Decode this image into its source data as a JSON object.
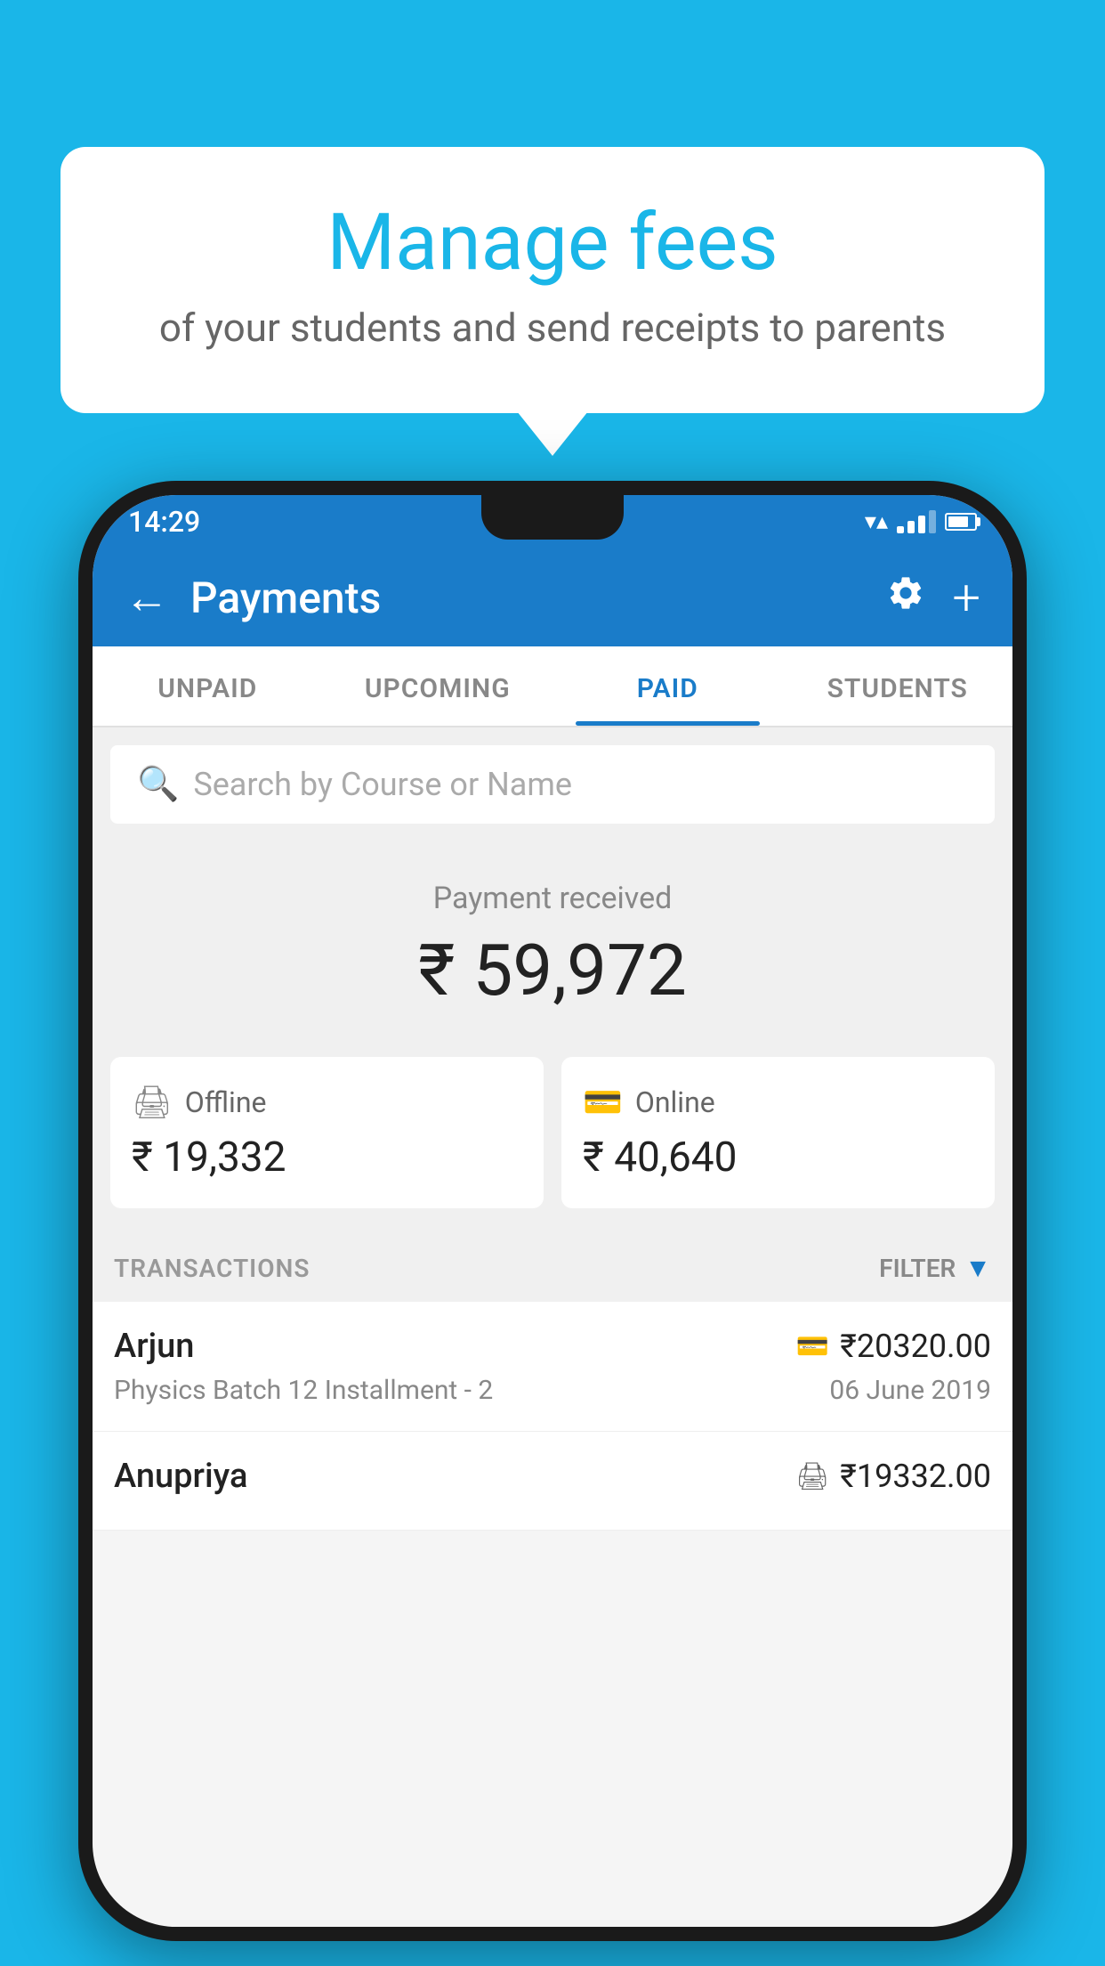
{
  "background_color": "#1ab6e8",
  "speech_bubble": {
    "title": "Manage fees",
    "subtitle": "of your students and send receipts to parents"
  },
  "status_bar": {
    "time": "14:29"
  },
  "app_bar": {
    "title": "Payments",
    "back_label": "←",
    "settings_label": "⚙",
    "add_label": "+"
  },
  "tabs": [
    {
      "label": "UNPAID",
      "active": false
    },
    {
      "label": "UPCOMING",
      "active": false
    },
    {
      "label": "PAID",
      "active": true
    },
    {
      "label": "STUDENTS",
      "active": false
    }
  ],
  "search": {
    "placeholder": "Search by Course or Name"
  },
  "payment_summary": {
    "label": "Payment received",
    "amount": "₹ 59,972"
  },
  "payment_cards": [
    {
      "icon": "offline",
      "label": "Offline",
      "amount": "₹ 19,332"
    },
    {
      "icon": "online",
      "label": "Online",
      "amount": "₹ 40,640"
    }
  ],
  "transactions_section": {
    "label": "TRANSACTIONS",
    "filter_label": "FILTER"
  },
  "transactions": [
    {
      "name": "Arjun",
      "course": "Physics Batch 12 Installment - 2",
      "amount": "₹20320.00",
      "date": "06 June 2019",
      "pay_type": "online"
    },
    {
      "name": "Anupriya",
      "course": "",
      "amount": "₹19332.00",
      "date": "",
      "pay_type": "offline"
    }
  ]
}
